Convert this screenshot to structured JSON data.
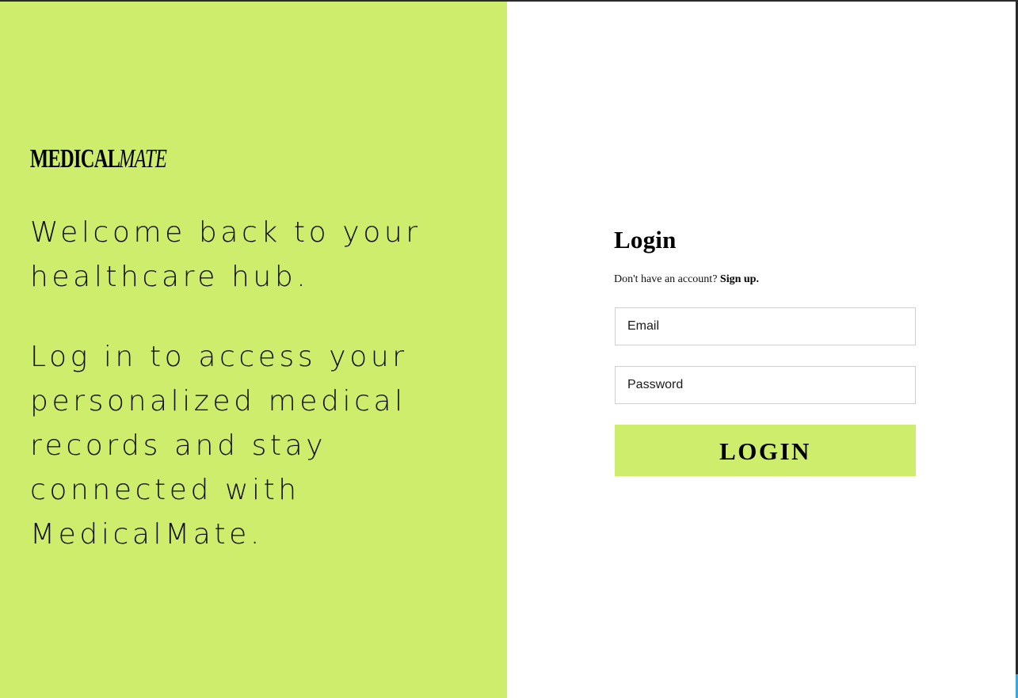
{
  "brand": {
    "name_bold": "Medical",
    "name_light": "Mate"
  },
  "hero": {
    "lines_para1": [
      "Welcome back to your",
      "healthcare hub."
    ],
    "lines_para2": [
      "Log in to access your",
      "personalized medical",
      "records and stay",
      "connected with",
      "MedicalMate."
    ]
  },
  "login": {
    "title": "Login",
    "signup_prompt": "Don't have an account?",
    "signup_link": "Sign up.",
    "email_placeholder": "Email",
    "password_placeholder": "Password",
    "button_label": "LOGIN"
  },
  "colors": {
    "accent": "#cfed6c",
    "text": "#000000",
    "input_border": "#cfcfcf"
  }
}
